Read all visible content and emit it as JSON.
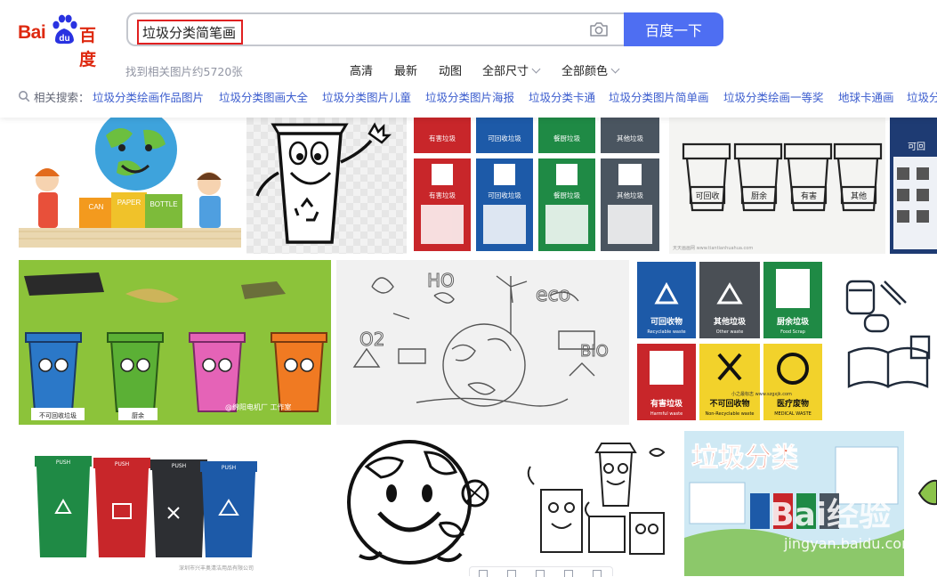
{
  "logo": {
    "latin": "Bai",
    "paw_text": "du",
    "chinese": "百度"
  },
  "search": {
    "query": "垃圾分类简笔画",
    "button_label": "百度一下"
  },
  "result_count": "找到相关图片约5720张",
  "filters": [
    {
      "label": "高清",
      "dropdown": false
    },
    {
      "label": "最新",
      "dropdown": false
    },
    {
      "label": "动图",
      "dropdown": false
    },
    {
      "label": "全部尺寸",
      "dropdown": true
    },
    {
      "label": "全部颜色",
      "dropdown": true
    }
  ],
  "related": {
    "label": "相关搜索：",
    "items": [
      "垃圾分类绘画作品图片",
      "垃圾分类图画大全",
      "垃圾分类图片儿童",
      "垃圾分类图片海报",
      "垃圾分类卡通",
      "垃圾分类图片简单画",
      "垃圾分类绘画一等奖",
      "地球卡通画",
      "垃圾分"
    ]
  },
  "tiles": {
    "kids_can": [
      "CAN",
      "PAPER",
      "BOTTLE"
    ],
    "bins_grid": [
      "有害垃圾",
      "可回收垃圾",
      "餐厨垃圾",
      "其他垃圾",
      "有害垃圾",
      "可回收垃圾",
      "餐厨垃圾",
      "其他垃圾"
    ],
    "bin_sketch": [
      "可回收",
      "厨余",
      "有害",
      "其他"
    ],
    "bin_sketch_watermark": "天天画画网 www.tiantianhuahua.com",
    "poster_right": "可回",
    "green_bins": [
      "不可回收垃圾",
      "厨余"
    ],
    "green_bins_watermark": "@绵阳电机厂 工作室",
    "eco_words": [
      "HO",
      "eco",
      "O2",
      "BIO"
    ],
    "sign_grid": [
      {
        "cn": "可回收物",
        "en": "Recyclable waste"
      },
      {
        "cn": "其他垃圾",
        "en": "Other waste"
      },
      {
        "cn": "厨余垃圾",
        "en": "Food Scrap"
      },
      {
        "cn": "有害垃圾",
        "en": "Harmful waste"
      },
      {
        "cn": "不可回收物",
        "en": "Non-Recyclable waste"
      },
      {
        "cn": "医疗废物",
        "en": "MEDICAL WASTE"
      }
    ],
    "sign_grid_watermark": "小之最标志 www.szgxjk.com",
    "four_bins_caption": "深圳市兴丰奥清洁用品有限公司",
    "push_label": "PUSH",
    "poster_title": "垃圾分类",
    "baidu_watermark": "Bai经验",
    "baidu_watermark_url": "jingyan.baidu.com"
  },
  "colors": {
    "accent": "#4e6ef2",
    "brand_red": "#de2910",
    "link": "#3b5cce",
    "bin_blue": "#1d5aa8",
    "bin_red": "#c8262a",
    "bin_green": "#1f8a45",
    "bin_gray": "#4a5560"
  }
}
